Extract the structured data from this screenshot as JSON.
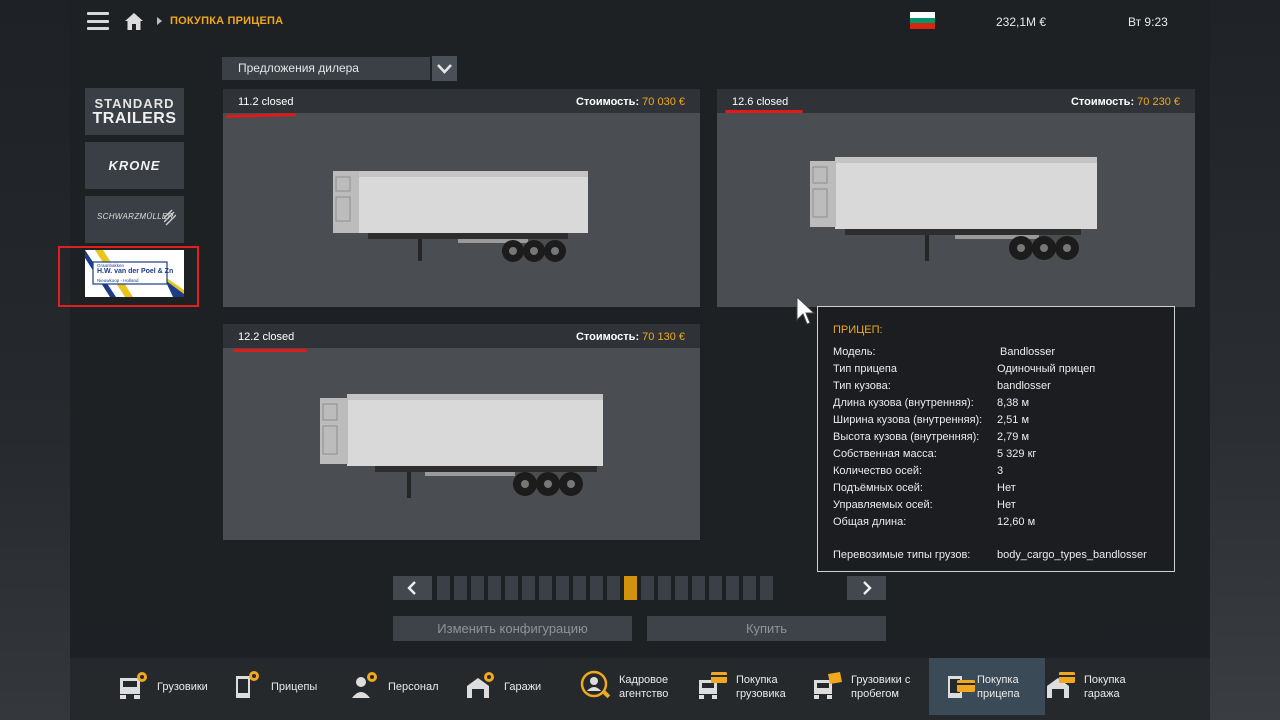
{
  "topbar": {
    "breadcrumb": "ПОКУПКА ПРИЦЕПА",
    "money": "232,1M  €",
    "clock": "Вт 9:23",
    "flag_colors": [
      "#ffffff",
      "#00966e",
      "#d62612"
    ]
  },
  "dealer_select": {
    "value": "Предложения дилера"
  },
  "brands": [
    {
      "line1": "STANDARD",
      "line2": "TRAILERS"
    },
    {
      "label": "KRONE"
    },
    {
      "label": "SCHWARZMÜLLER"
    },
    {
      "label_top": "Graanbakken",
      "label": "H.W. van der Poel & Zn",
      "label_bottom": "Nieuwkoop - Holland",
      "active": true
    }
  ],
  "offers": [
    {
      "title": "11.2 closed",
      "price_label": "Стоимость:",
      "price": "70 030 €"
    },
    {
      "title": "12.6 closed",
      "price_label": "Стоимость:",
      "price": "70 230 €"
    },
    {
      "title": "12.2 closed",
      "price_label": "Стоимость:",
      "price": "70 130 €"
    }
  ],
  "tooltip": {
    "heading": "ПРИЦЕП:",
    "rows": [
      {
        "k": "Модель:",
        "v": "Bandlosser"
      },
      {
        "k": "Тип прицепа",
        "v": "Одиночный прицеп"
      },
      {
        "k": "Тип кузова:",
        "v": "bandlosser"
      },
      {
        "k": "Длина кузова (внутренняя):",
        "v": "8,38 м"
      },
      {
        "k": "Ширина кузова (внутренняя):",
        "v": "2,51 м"
      },
      {
        "k": "Высота кузова (внутренняя):",
        "v": "2,79 м"
      },
      {
        "k": "Собственная масса:",
        "v": "5 329 кг"
      },
      {
        "k": "Количество осей:",
        "v": "3"
      },
      {
        "k": "Подъёмных осей:",
        "v": "Нет"
      },
      {
        "k": "Управляемых осей:",
        "v": "Нет"
      },
      {
        "k": "Общая длина:",
        "v": "12,60 м"
      },
      {
        "k": "Перевозимые типы грузов:",
        "v": "body_cargo_types_bandlosser"
      }
    ]
  },
  "pagination": {
    "total": 20,
    "current": 11
  },
  "actions": {
    "configure": "Изменить конфигурацию",
    "buy": "Купить"
  },
  "nav": [
    {
      "label": "Грузовики",
      "icon": "truck-gear-icon"
    },
    {
      "label": "Прицепы",
      "icon": "trailer-gear-icon"
    },
    {
      "label": "Персонал",
      "icon": "person-gear-icon"
    },
    {
      "label": "Гаражи",
      "icon": "garage-gear-icon"
    },
    {
      "label": "Кадровое\nагентство",
      "icon": "recruitment-agency-icon"
    },
    {
      "label": "Покупка\nгрузовика",
      "icon": "buy-truck-icon"
    },
    {
      "label": "Грузовики с\nпробегом",
      "icon": "used-truck-icon"
    },
    {
      "label": "Покупка\nприцепа",
      "icon": "buy-trailer-icon",
      "active": true
    },
    {
      "label": "Покупка\nгаража",
      "icon": "buy-garage-icon"
    }
  ]
}
